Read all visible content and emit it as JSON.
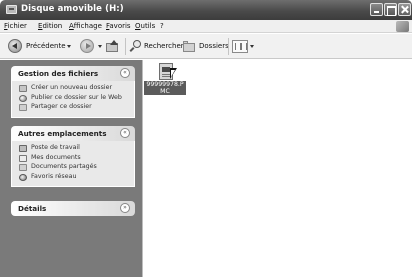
{
  "window": {
    "title": "Disque amovible (H:)"
  },
  "menu": [
    "Fichier",
    "Edition",
    "Affichage",
    "Favoris",
    "Outils",
    "?"
  ],
  "toolbar": {
    "back_label": "Précédente",
    "search_label": "Rechercher",
    "folders_label": "Dossiers"
  },
  "tasks": {
    "file_tasks": {
      "title": "Gestion des fichiers",
      "items": [
        "Créer un nouveau dossier",
        "Publier ce dossier sur le Web",
        "Partager ce dossier"
      ]
    },
    "other_places": {
      "title": "Autres emplacements",
      "items": [
        "Poste de travail",
        "Mes documents",
        "Documents partagés",
        "Favoris réseau"
      ]
    },
    "details": {
      "title": "Détails"
    }
  },
  "files": [
    {
      "name": "99999978.PMC"
    }
  ],
  "icons": {
    "section_collapse": "«",
    "section_expand": "»"
  }
}
